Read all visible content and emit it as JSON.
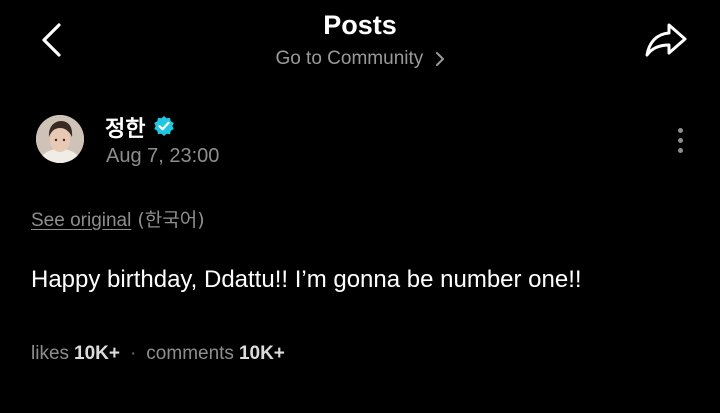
{
  "header": {
    "title": "Posts",
    "community_link": "Go to Community",
    "back_icon": "chevron-left-icon",
    "share_icon": "share-arrow-icon",
    "link_chevron_icon": "chevron-right-icon"
  },
  "post": {
    "author": "정한",
    "verified_icon": "verified-badge-icon",
    "verified_color": "#1fc7e0",
    "timestamp": "Aug 7, 23:00",
    "more_icon": "more-vertical-icon",
    "see_original": "See original",
    "original_language": "(한국어)",
    "body": "Happy birthday, Ddattu!! I’m gonna be number one!!"
  },
  "stats": {
    "likes_label": "likes",
    "likes_value": "10K+",
    "separator": "·",
    "comments_label": "comments",
    "comments_value": "10K+"
  },
  "colors": {
    "background": "#000000",
    "primary_text": "#ffffff",
    "secondary_text": "#8e8e8e"
  }
}
